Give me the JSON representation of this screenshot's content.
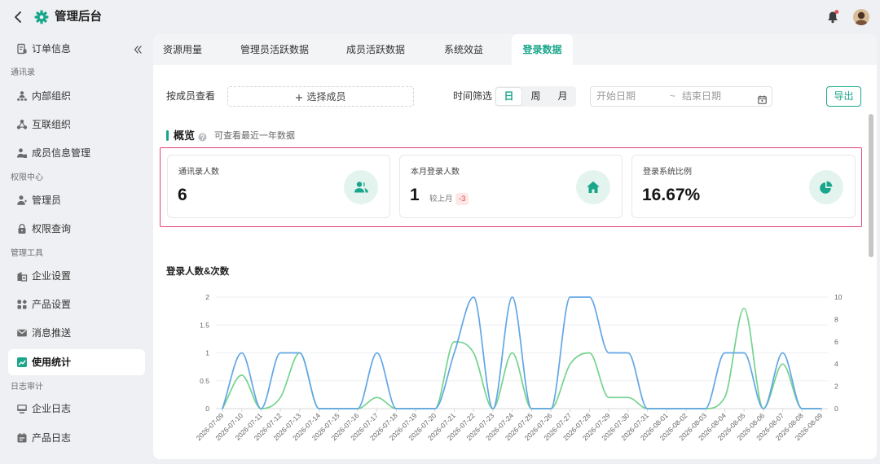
{
  "app": {
    "title": "管理后台"
  },
  "header": {
    "notification_dot_color": "#e5484d",
    "bell_icon": "bell-icon",
    "avatar_icon": "user-avatar"
  },
  "sidebar": {
    "collapse_icon": "double-chevron-left-icon",
    "top_item": {
      "label": "订单信息",
      "icon": "order-icon"
    },
    "groups": [
      {
        "title": "通讯录",
        "items": [
          {
            "label": "内部组织",
            "icon": "org-structure-icon"
          },
          {
            "label": "互联组织",
            "icon": "interconnect-icon"
          },
          {
            "label": "成员信息管理",
            "icon": "member-icon"
          }
        ]
      },
      {
        "title": "权限中心",
        "items": [
          {
            "label": "管理员",
            "icon": "admin-icon"
          },
          {
            "label": "权限查询",
            "icon": "lock-icon"
          }
        ]
      },
      {
        "title": "管理工具",
        "items": [
          {
            "label": "企业设置",
            "icon": "enterprise-settings-icon"
          },
          {
            "label": "产品设置",
            "icon": "grid-icon"
          },
          {
            "label": "消息推送",
            "icon": "mail-icon"
          },
          {
            "label": "使用统计",
            "icon": "stats-icon",
            "active": true
          }
        ]
      },
      {
        "title": "日志审计",
        "items": [
          {
            "label": "企业日志",
            "icon": "log-icon"
          },
          {
            "label": "产品日志",
            "icon": "product-log-icon"
          }
        ]
      }
    ]
  },
  "tabs": [
    {
      "label": "资源用量"
    },
    {
      "label": "管理员活跃数据"
    },
    {
      "label": "成员活跃数据"
    },
    {
      "label": "系统效益"
    },
    {
      "label": "登录数据",
      "active": true
    }
  ],
  "filters": {
    "member_label": "按成员查看",
    "member_select": "选择成员",
    "time_label": "时间筛选",
    "granularity": [
      "日",
      "周",
      "月"
    ],
    "selected_index": 0,
    "start_placeholder": "开始日期",
    "separator": "~",
    "end_placeholder": "结束日期",
    "export_label": "导出"
  },
  "overview": {
    "title": "概览",
    "hint": "可查看最近一年数据",
    "cards": [
      {
        "label": "通讯录人数",
        "value": "6",
        "icon": "contacts-icon"
      },
      {
        "label": "本月登录人数",
        "value": "1",
        "compare_label": "较上月",
        "compare_value": "-3",
        "icon": "home-icon"
      },
      {
        "label": "登录系统比例",
        "value": "16.67%",
        "icon": "pie-chart-icon"
      }
    ]
  },
  "colors": {
    "accent": "#19a68a",
    "accent_light": "#e3f4ef",
    "highlight_border": "#e2407c",
    "negative": "#e5484d",
    "series_blue": "#62a6e6",
    "series_green": "#74d38e"
  },
  "chart_data": {
    "type": "line",
    "title": "登录人数&次数",
    "smooth": true,
    "grid": true,
    "x": [
      "2026-07-09",
      "2026-07-10",
      "2026-07-11",
      "2026-07-12",
      "2026-07-13",
      "2026-07-14",
      "2026-07-15",
      "2026-07-16",
      "2026-07-17",
      "2026-07-18",
      "2026-07-19",
      "2026-07-20",
      "2026-07-21",
      "2026-07-22",
      "2026-07-23",
      "2026-07-24",
      "2026-07-25",
      "2026-07-26",
      "2026-07-27",
      "2026-07-28",
      "2026-07-29",
      "2026-07-30",
      "2026-07-31",
      "2026-08-01",
      "2026-08-02",
      "2026-08-03",
      "2026-08-04",
      "2026-08-05",
      "2026-08-06",
      "2026-08-07",
      "2026-08-08",
      "2026-08-09"
    ],
    "y_left": {
      "range": [
        0,
        2
      ],
      "ticks": [
        0,
        0.5,
        1,
        1.5,
        2
      ]
    },
    "y_right": {
      "range": [
        0,
        10
      ],
      "ticks": [
        0,
        2,
        4,
        6,
        8,
        10
      ]
    },
    "series": [
      {
        "y_axis": "left",
        "color": "#62a6e6",
        "values": [
          0,
          1,
          0,
          1,
          1,
          0,
          0,
          0,
          1,
          0,
          0,
          0,
          1,
          2,
          0,
          2,
          0,
          0,
          2,
          2,
          1,
          1,
          0,
          0,
          0,
          0,
          1,
          1,
          0,
          1,
          0,
          0
        ]
      },
      {
        "y_axis": "right",
        "color": "#74d38e",
        "values": [
          0,
          3,
          0,
          1,
          5,
          0,
          0,
          0,
          1,
          0,
          0,
          0,
          6,
          5,
          0,
          5,
          0,
          0,
          4,
          5,
          1,
          1,
          0,
          0,
          0,
          0,
          1,
          9,
          0,
          4,
          0,
          0
        ]
      }
    ]
  }
}
